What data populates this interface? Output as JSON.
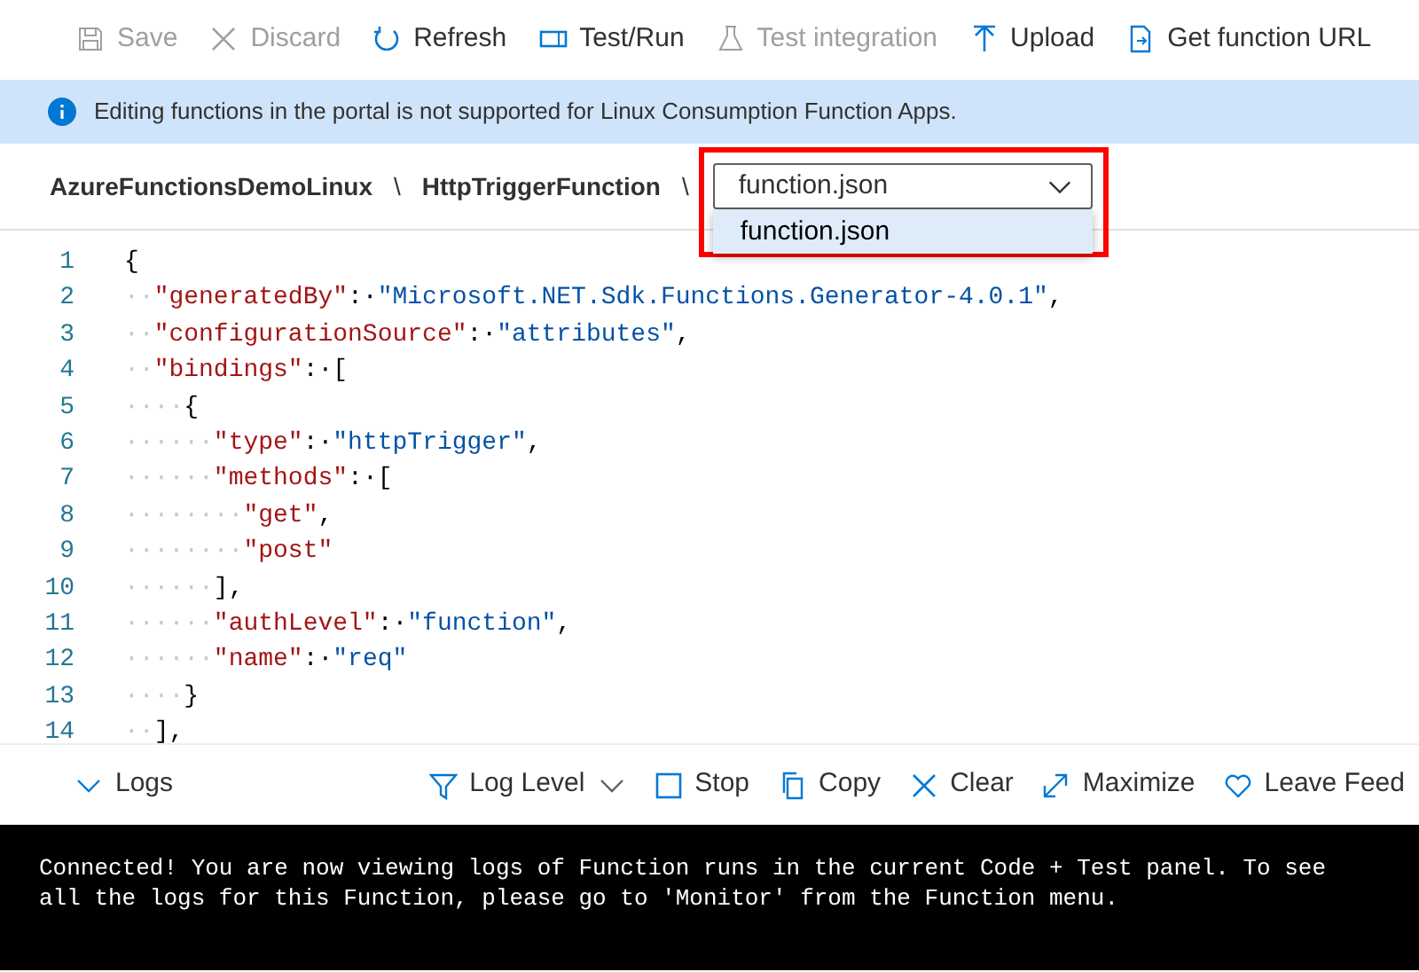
{
  "toolbar": [
    {
      "label": "Save",
      "kind": "save",
      "disabled": true
    },
    {
      "label": "Discard",
      "kind": "close",
      "disabled": true
    },
    {
      "label": "Refresh",
      "kind": "refresh",
      "disabled": false
    },
    {
      "label": "Test/Run",
      "kind": "testrun",
      "disabled": false
    },
    {
      "label": "Test integration",
      "kind": "flask",
      "disabled": true
    },
    {
      "label": "Upload",
      "kind": "upload",
      "disabled": false
    },
    {
      "label": "Get function URL",
      "kind": "url",
      "disabled": false
    }
  ],
  "info_bar": {
    "message": "Editing functions in the portal is not supported for Linux Consumption Function Apps."
  },
  "breadcrumb": {
    "items": [
      "AzureFunctionsDemoLinux",
      "HttpTriggerFunction"
    ],
    "separators": [
      "\\",
      "\\"
    ]
  },
  "file_selector": {
    "value": "function.json",
    "highlighted": true,
    "options": [
      {
        "label": "function.json",
        "selected": true
      }
    ]
  },
  "editor": {
    "lines": [
      {
        "number": "1",
        "tokens": [
          {
            "kind": "punct",
            "text": "{"
          }
        ]
      },
      {
        "number": "2",
        "tokens": [
          {
            "kind": "ws",
            "text": "··"
          },
          {
            "kind": "key",
            "text": "\"generatedBy\""
          },
          {
            "kind": "punct",
            "text": ":·"
          },
          {
            "kind": "string",
            "text": "\"Microsoft.NET.Sdk.Functions.Generator-4.0.1\""
          },
          {
            "kind": "punct",
            "text": ","
          }
        ]
      },
      {
        "number": "3",
        "tokens": [
          {
            "kind": "ws",
            "text": "··"
          },
          {
            "kind": "key",
            "text": "\"configurationSource\""
          },
          {
            "kind": "punct",
            "text": ":·"
          },
          {
            "kind": "string",
            "text": "\"attributes\""
          },
          {
            "kind": "punct",
            "text": ","
          }
        ]
      },
      {
        "number": "4",
        "tokens": [
          {
            "kind": "ws",
            "text": "··"
          },
          {
            "kind": "key",
            "text": "\"bindings\""
          },
          {
            "kind": "punct",
            "text": ":·["
          }
        ]
      },
      {
        "number": "5",
        "tokens": [
          {
            "kind": "ws",
            "text": "····"
          },
          {
            "kind": "punct",
            "text": "{"
          }
        ]
      },
      {
        "number": "6",
        "tokens": [
          {
            "kind": "ws",
            "text": "······"
          },
          {
            "kind": "key",
            "text": "\"type\""
          },
          {
            "kind": "punct",
            "text": ":·"
          },
          {
            "kind": "string",
            "text": "\"httpTrigger\""
          },
          {
            "kind": "punct",
            "text": ","
          }
        ]
      },
      {
        "number": "7",
        "tokens": [
          {
            "kind": "ws",
            "text": "······"
          },
          {
            "kind": "key",
            "text": "\"methods\""
          },
          {
            "kind": "punct",
            "text": ":·["
          }
        ]
      },
      {
        "number": "8",
        "tokens": [
          {
            "kind": "ws",
            "text": "········"
          },
          {
            "kind": "key",
            "text": "\"get\""
          },
          {
            "kind": "punct",
            "text": ","
          }
        ]
      },
      {
        "number": "9",
        "tokens": [
          {
            "kind": "ws",
            "text": "········"
          },
          {
            "kind": "key",
            "text": "\"post\""
          }
        ]
      },
      {
        "number": "10",
        "tokens": [
          {
            "kind": "ws",
            "text": "······"
          },
          {
            "kind": "punct",
            "text": "],"
          }
        ]
      },
      {
        "number": "11",
        "tokens": [
          {
            "kind": "ws",
            "text": "······"
          },
          {
            "kind": "key",
            "text": "\"authLevel\""
          },
          {
            "kind": "punct",
            "text": ":·"
          },
          {
            "kind": "string",
            "text": "\"function\""
          },
          {
            "kind": "punct",
            "text": ","
          }
        ]
      },
      {
        "number": "12",
        "tokens": [
          {
            "kind": "ws",
            "text": "······"
          },
          {
            "kind": "key",
            "text": "\"name\""
          },
          {
            "kind": "punct",
            "text": ":·"
          },
          {
            "kind": "string",
            "text": "\"req\""
          }
        ]
      },
      {
        "number": "13",
        "tokens": [
          {
            "kind": "ws",
            "text": "····"
          },
          {
            "kind": "punct",
            "text": "}"
          }
        ]
      },
      {
        "number": "14",
        "tokens": [
          {
            "kind": "ws",
            "text": "··"
          },
          {
            "kind": "punct",
            "text": "],"
          }
        ]
      }
    ]
  },
  "logs_toolbar": {
    "toggle": {
      "label": "Logs",
      "expanded": true
    },
    "actions": [
      {
        "label": "Log Level",
        "kind": "filter",
        "dropdown": true
      },
      {
        "label": "Stop",
        "kind": "stop",
        "dropdown": false
      },
      {
        "label": "Copy",
        "kind": "copy",
        "dropdown": false
      },
      {
        "label": "Clear",
        "kind": "close",
        "dropdown": false
      },
      {
        "label": "Maximize",
        "kind": "maximize",
        "dropdown": false
      },
      {
        "label": "Leave Feed",
        "kind": "heart",
        "dropdown": false
      }
    ]
  },
  "console": {
    "message": "Connected! You are now viewing logs of Function runs in the current Code + Test panel. To see all the logs for this Function, please go to 'Monitor' from the Function menu."
  }
}
